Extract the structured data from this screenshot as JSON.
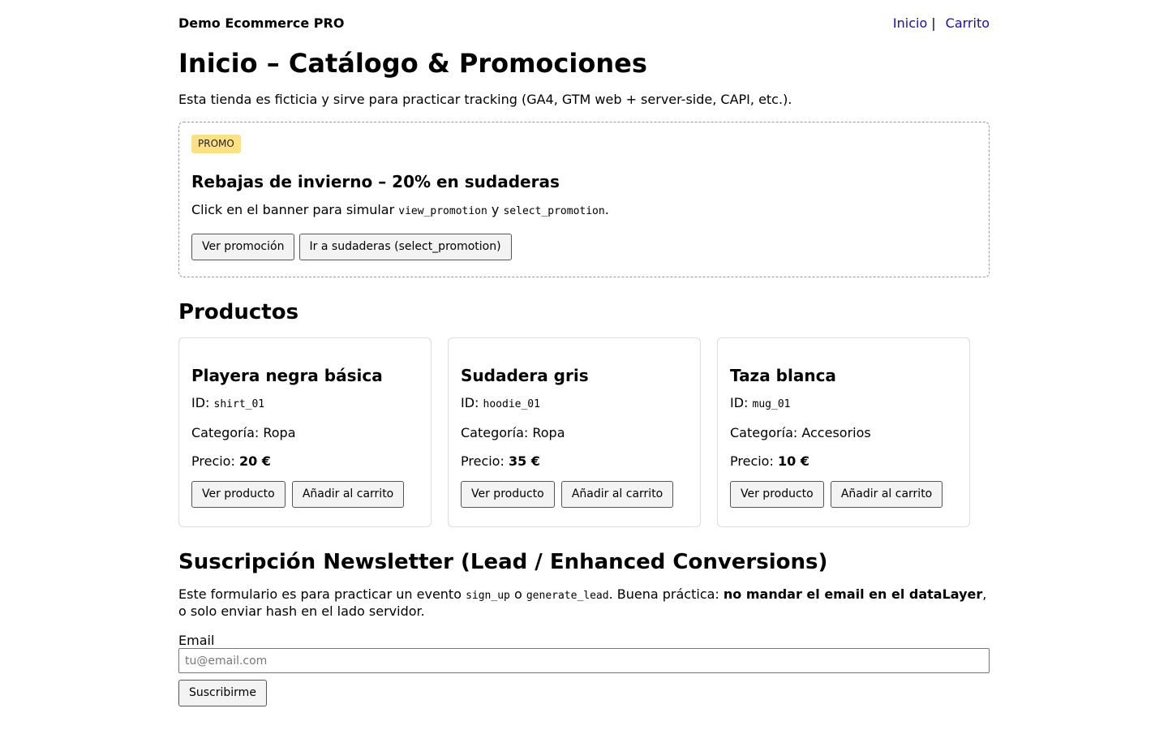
{
  "header": {
    "brand": "Demo Ecommerce PRO",
    "nav": {
      "home": "Inicio",
      "separator": "|",
      "cart": "Carrito"
    }
  },
  "page_title": "Inicio – Catálogo & Promociones",
  "intro": "Esta tienda es ficticia y sirve para practicar tracking (GA4, GTM web + server-side, CAPI, etc.).",
  "promo": {
    "badge": "PROMO",
    "title": "Rebajas de invierno – 20% en sudaderas",
    "desc_before": "Click en el banner para simular ",
    "code1": "view_promotion",
    "desc_mid": " y ",
    "code2": "select_promotion",
    "desc_after": ".",
    "view_button": "Ver promoción",
    "select_button": "Ir a sudaderas (select_promotion)",
    "badge_color": "#ffe082"
  },
  "products": {
    "heading": "Productos",
    "id_label": "ID: ",
    "category_label": "Categoría: ",
    "price_label": "Precio: ",
    "view_button": "Ver producto",
    "add_button": "Añadir al carrito",
    "items": [
      {
        "name": "Playera negra básica",
        "id": "shirt_01",
        "category": "Ropa",
        "price": "20 €"
      },
      {
        "name": "Sudadera gris",
        "id": "hoodie_01",
        "category": "Ropa",
        "price": "35 €"
      },
      {
        "name": "Taza blanca",
        "id": "mug_01",
        "category": "Accesorios",
        "price": "10 €"
      }
    ]
  },
  "newsletter": {
    "heading": "Suscripción Newsletter (Lead / Enhanced Conversions)",
    "desc_1": "Este formulario es para practicar un evento ",
    "code1": "sign_up",
    "desc_2": " o ",
    "code2": "generate_lead",
    "desc_3": ". Buena práctica: ",
    "desc_bold": "no mandar el email en el dataLayer",
    "desc_4": ", o solo enviar hash en el lado servidor.",
    "email_label": "Email",
    "email_placeholder": "tu@email.com",
    "email_value": "",
    "submit_button": "Suscribirme"
  },
  "colors": {
    "link": "#1a0dab"
  }
}
